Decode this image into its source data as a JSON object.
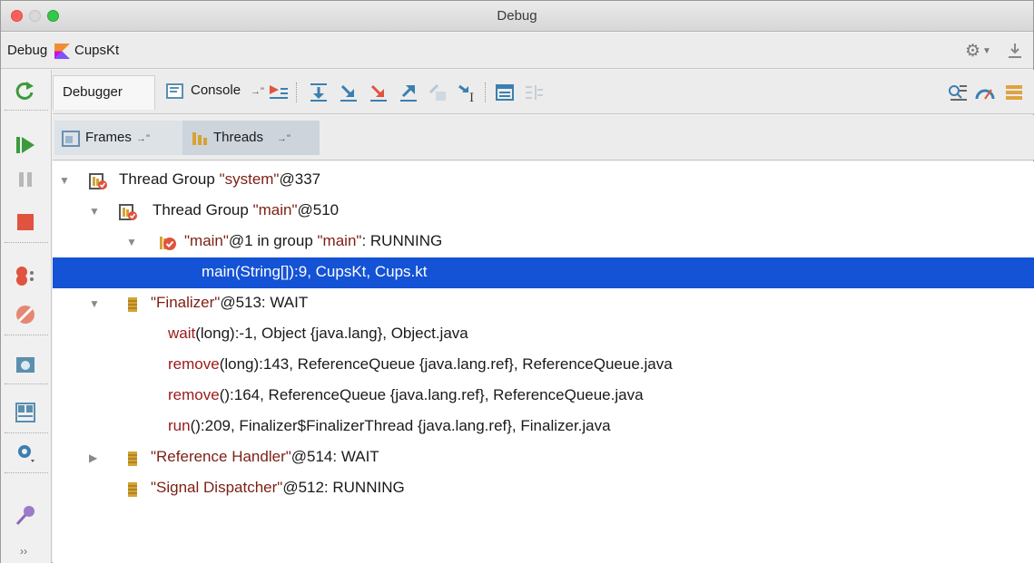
{
  "window": {
    "title": "Debug"
  },
  "header": {
    "label": "Debug",
    "run_config": "CupsKt"
  },
  "toolbar": {
    "debugger_tab": "Debugger",
    "console_tab": "Console",
    "tab_pin": "→\""
  },
  "subtabs": [
    {
      "label": "Frames",
      "pin": "→\""
    },
    {
      "label": "Threads",
      "pin": "→\""
    }
  ],
  "threads": [
    {
      "segments": [
        {
          "t": "Thread Group ",
          "c": ""
        },
        {
          "t": "\"system\"",
          "c": "str"
        },
        {
          "t": "@337",
          "c": ""
        }
      ],
      "arrow": "▼"
    },
    {
      "segments": [
        {
          "t": "Thread Group ",
          "c": ""
        },
        {
          "t": "\"main\"",
          "c": "str"
        },
        {
          "t": "@510",
          "c": ""
        }
      ],
      "arrow": "▼"
    },
    {
      "segments": [
        {
          "t": "\"main\"",
          "c": "str"
        },
        {
          "t": "@1 in group ",
          "c": ""
        },
        {
          "t": "\"main\"",
          "c": "str"
        },
        {
          "t": ": RUNNING",
          "c": ""
        }
      ],
      "arrow": "▼"
    },
    {
      "segments": [
        {
          "t": "main(String[]):9, CupsKt, Cups.kt",
          "c": ""
        }
      ],
      "selected": true
    },
    {
      "segments": [
        {
          "t": "\"Finalizer\"",
          "c": "str"
        },
        {
          "t": "@513: WAIT",
          "c": ""
        }
      ],
      "arrow": "▼"
    },
    {
      "segments": [
        {
          "t": "wait",
          "c": "meth"
        },
        {
          "t": "(long):-1, Object {java.lang}, Object.java",
          "c": ""
        }
      ]
    },
    {
      "segments": [
        {
          "t": "remove",
          "c": "meth"
        },
        {
          "t": "(long):143, ReferenceQueue {java.lang.ref}, ReferenceQueue.java",
          "c": ""
        }
      ]
    },
    {
      "segments": [
        {
          "t": "remove",
          "c": "meth"
        },
        {
          "t": "():164, ReferenceQueue {java.lang.ref}, ReferenceQueue.java",
          "c": ""
        }
      ]
    },
    {
      "segments": [
        {
          "t": "run",
          "c": "meth"
        },
        {
          "t": "():209, Finalizer$FinalizerThread {java.lang.ref}, Finalizer.java",
          "c": ""
        }
      ]
    },
    {
      "segments": [
        {
          "t": "\"Reference Handler\"",
          "c": "str"
        },
        {
          "t": "@514: WAIT",
          "c": ""
        }
      ],
      "arrow": "▶"
    },
    {
      "segments": [
        {
          "t": "\"Signal Dispatcher\"",
          "c": "str"
        },
        {
          "t": "@512: RUNNING",
          "c": ""
        }
      ]
    }
  ],
  "icons": {
    "leftbar": [
      "rerun-icon",
      "resume-icon",
      "pause-icon",
      "stop-icon",
      "view-breakpoints-icon",
      "mute-breakpoints-icon",
      "get-thread-dump-icon",
      "restore-layout-icon",
      "settings-icon",
      "pin-tab-icon",
      "more-icon"
    ]
  }
}
